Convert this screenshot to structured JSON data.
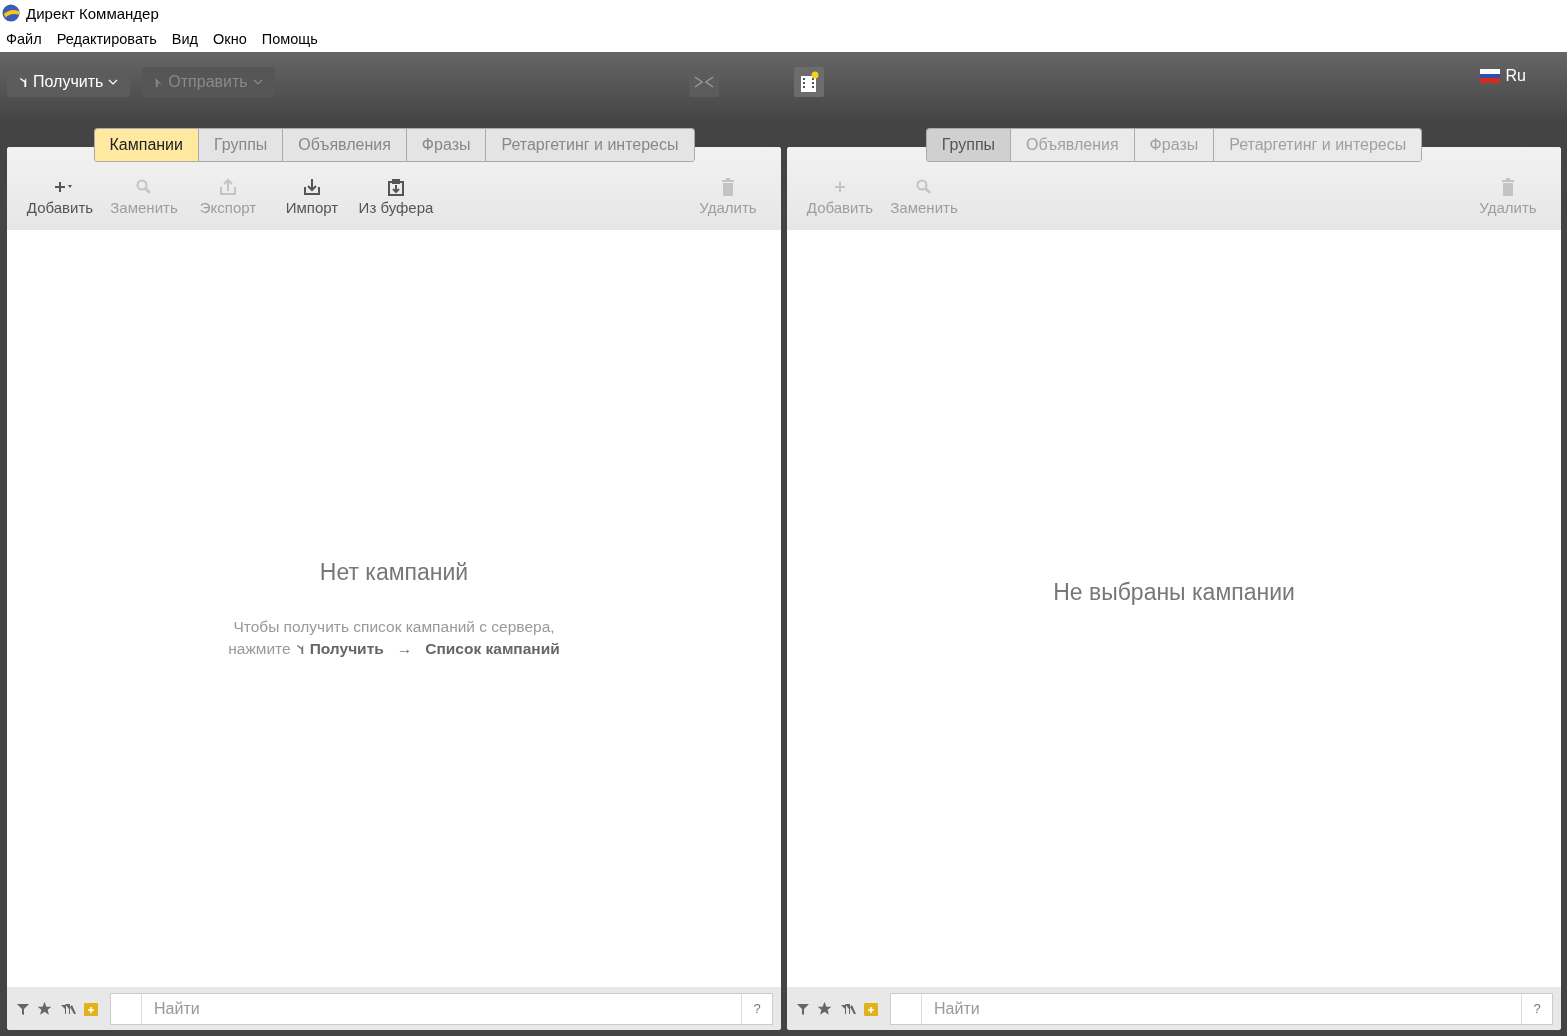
{
  "window": {
    "title": "Директ Коммандер"
  },
  "menu": [
    "Файл",
    "Редактировать",
    "Вид",
    "Окно",
    "Помощь"
  ],
  "toolbar": {
    "buttons": [
      {
        "label": "Получить",
        "kind": "get",
        "disabled": false
      },
      {
        "label": "Отправить",
        "kind": "send",
        "disabled": true
      }
    ],
    "language": "Ru"
  },
  "panels": [
    {
      "tabs": [
        {
          "label": "Кампании",
          "selected": true,
          "disabled": false
        },
        {
          "label": "Группы",
          "selected": false,
          "disabled": false
        },
        {
          "label": "Объявления",
          "selected": false,
          "disabled": false
        },
        {
          "label": "Фразы",
          "selected": false,
          "disabled": false
        },
        {
          "label": "Ретаргетинг и интересы",
          "selected": false,
          "disabled": false
        }
      ],
      "actions": [
        {
          "label": "Добавить",
          "kind": "add",
          "disabled": false
        },
        {
          "label": "Заменить",
          "kind": "replace",
          "disabled": true
        },
        {
          "label": "Экспорт",
          "kind": "export",
          "disabled": true
        },
        {
          "label": "Импорт",
          "kind": "import",
          "disabled": false
        },
        {
          "label": "Из буфера",
          "kind": "clipboard",
          "disabled": false
        },
        {
          "label": "Удалить",
          "kind": "delete",
          "disabled": true
        }
      ],
      "empty_title": "Нет кампаний",
      "hint": {
        "line": "Чтобы получить список кампаний с сервера,",
        "prefix": "нажмите",
        "command": "Получить",
        "arrow": "→",
        "item": "Список кампаний"
      },
      "search": {
        "placeholder": "Найти",
        "help": "?"
      }
    },
    {
      "tabs": [
        {
          "label": "Группы",
          "selected": true,
          "disabled": false
        },
        {
          "label": "Объявления",
          "selected": false,
          "disabled": true
        },
        {
          "label": "Фразы",
          "selected": false,
          "disabled": true
        },
        {
          "label": "Ретаргетинг и интересы",
          "selected": false,
          "disabled": true
        }
      ],
      "actions": [
        {
          "label": "Добавить",
          "kind": "add",
          "disabled": true
        },
        {
          "label": "Заменить",
          "kind": "replace",
          "disabled": true
        },
        {
          "label": "Удалить",
          "kind": "delete",
          "disabled": true
        }
      ],
      "empty_title": "Не выбраны кампании",
      "search": {
        "placeholder": "Найти",
        "help": "?"
      }
    }
  ]
}
